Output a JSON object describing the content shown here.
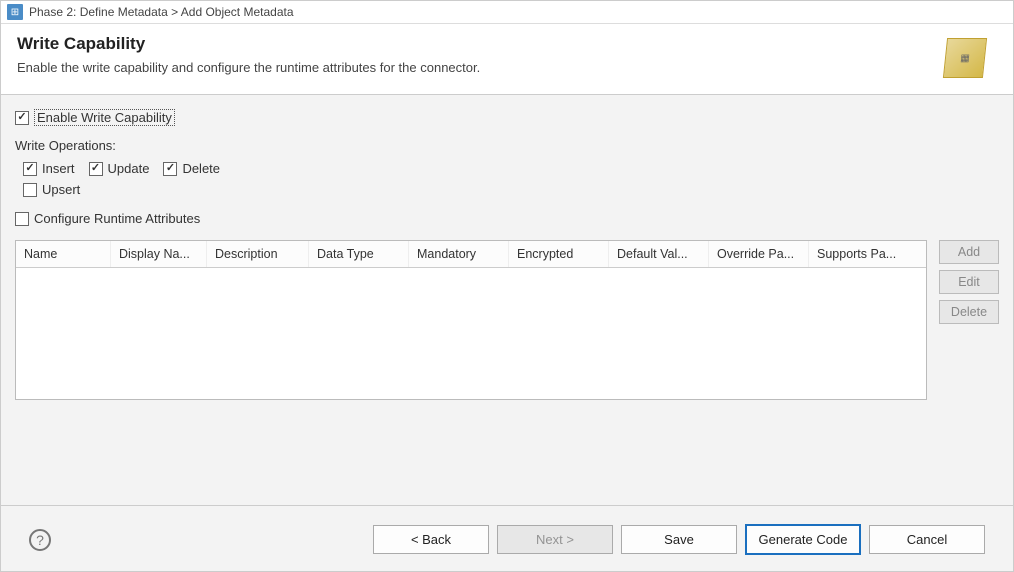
{
  "titlebar": {
    "text": "Phase 2: Define Metadata > Add Object Metadata"
  },
  "header": {
    "title": "Write Capability",
    "subtitle": "Enable the write capability and configure the runtime attributes for the connector."
  },
  "form": {
    "enable_label": "Enable Write Capability",
    "enable_checked": true,
    "ops_label": "Write Operations:",
    "ops": {
      "insert": {
        "label": "Insert",
        "checked": true
      },
      "update": {
        "label": "Update",
        "checked": true
      },
      "delete": {
        "label": "Delete",
        "checked": true
      },
      "upsert": {
        "label": "Upsert",
        "checked": false
      }
    },
    "config_attr": {
      "label": "Configure Runtime Attributes",
      "checked": false
    }
  },
  "table": {
    "columns": [
      "Name",
      "Display Na...",
      "Description",
      "Data Type",
      "Mandatory",
      "Encrypted",
      "Default Val...",
      "Override Pa...",
      "Supports Pa..."
    ]
  },
  "actions": {
    "add": "Add",
    "edit": "Edit",
    "delete": "Delete"
  },
  "footer": {
    "back": "< Back",
    "next": "Next >",
    "save": "Save",
    "generate": "Generate Code",
    "cancel": "Cancel"
  }
}
